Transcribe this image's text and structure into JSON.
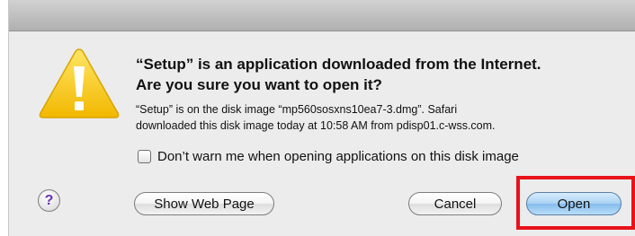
{
  "dialog": {
    "headline_line1": "“Setup” is an application downloaded from the Internet.",
    "headline_line2": "Are you sure you want to open it?",
    "body_line1": "“Setup” is on the disk image “mp560sosxns10ea7-3.dmg”. Safari",
    "body_line2": "downloaded this disk image today at 10:58 AM from pdisp01.c-wss.com.",
    "checkbox_label": "Don’t warn me when opening applications on this disk image",
    "checkbox_checked": false,
    "help_label": "?",
    "icon": "warning-icon"
  },
  "buttons": {
    "show_web_page": "Show Web Page",
    "cancel": "Cancel",
    "open": "Open"
  },
  "colors": {
    "highlight": "#e8121a",
    "default_button": "#a9d2f3",
    "warning": "#f5c400"
  }
}
